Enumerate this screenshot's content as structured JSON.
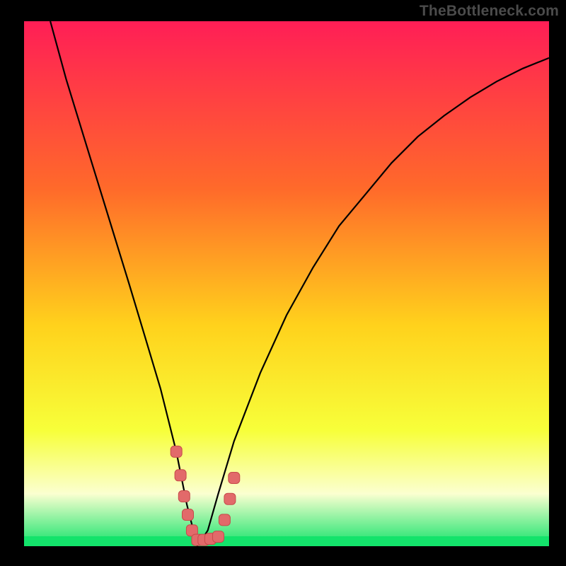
{
  "watermark": "TheBottleneck.com",
  "colors": {
    "gradient_top": "#ff1e56",
    "gradient_upper_mid": "#ff6a2a",
    "gradient_mid": "#ffd21c",
    "gradient_lower_mid": "#f7ff3a",
    "gradient_low_band": "#fbffd0",
    "gradient_bottom": "#13e36b",
    "curve": "#000000",
    "marker_fill": "#e26a6a",
    "marker_stroke": "#c64a4a",
    "frame": "#000000"
  },
  "chart_data": {
    "type": "line",
    "title": "",
    "xlabel": "",
    "ylabel": "",
    "xlim": [
      0,
      100
    ],
    "ylim": [
      0,
      100
    ],
    "x_optimum": 33,
    "series": [
      {
        "name": "bottleneck-curve",
        "x": [
          5,
          8,
          12,
          16,
          20,
          23,
          26,
          29,
          31,
          33,
          35,
          37,
          40,
          45,
          50,
          55,
          60,
          65,
          70,
          75,
          80,
          85,
          90,
          95,
          100
        ],
        "y": [
          100,
          89,
          76,
          63,
          50,
          40,
          30,
          18,
          8,
          0,
          3,
          10,
          20,
          33,
          44,
          53,
          61,
          67,
          73,
          78,
          82,
          85.5,
          88.5,
          91,
          93
        ]
      }
    ],
    "markers": {
      "name": "highlighted-range",
      "points": [
        {
          "x": 29.0,
          "y": 18.0
        },
        {
          "x": 29.8,
          "y": 13.5
        },
        {
          "x": 30.5,
          "y": 9.5
        },
        {
          "x": 31.2,
          "y": 6.0
        },
        {
          "x": 32.0,
          "y": 3.0
        },
        {
          "x": 33.0,
          "y": 1.2
        },
        {
          "x": 34.2,
          "y": 1.2
        },
        {
          "x": 35.5,
          "y": 1.4
        },
        {
          "x": 37.0,
          "y": 1.8
        },
        {
          "x": 38.2,
          "y": 5.0
        },
        {
          "x": 39.2,
          "y": 9.0
        },
        {
          "x": 40.0,
          "y": 13.0
        }
      ]
    }
  }
}
